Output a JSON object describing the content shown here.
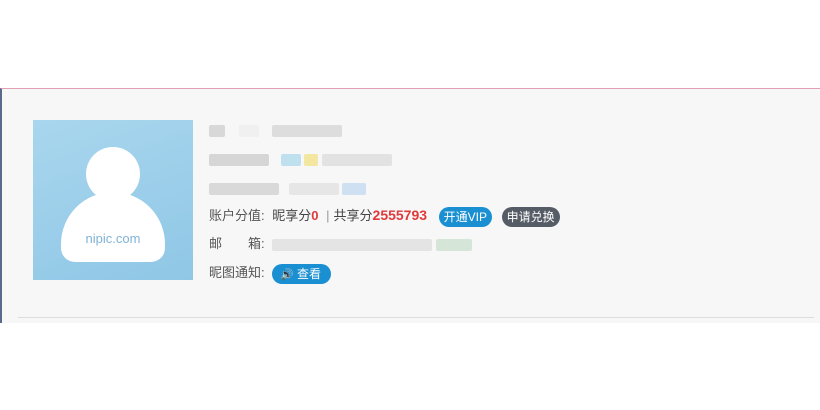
{
  "account": {
    "points_label": "账户分值:",
    "nipic_points_label": "昵享分",
    "nipic_points_value": "0",
    "separator": "|",
    "shared_points_label": "共享分",
    "shared_points_value": "2555793",
    "vip_button": "开通VIP",
    "exchange_button": "申请兑换"
  },
  "email": {
    "label": "邮　　箱:"
  },
  "notice": {
    "label": "昵图通知:",
    "view_button": "查看"
  },
  "avatar": {
    "watermark": "nipic.com"
  },
  "icons": {
    "speaker": "speaker-icon"
  }
}
